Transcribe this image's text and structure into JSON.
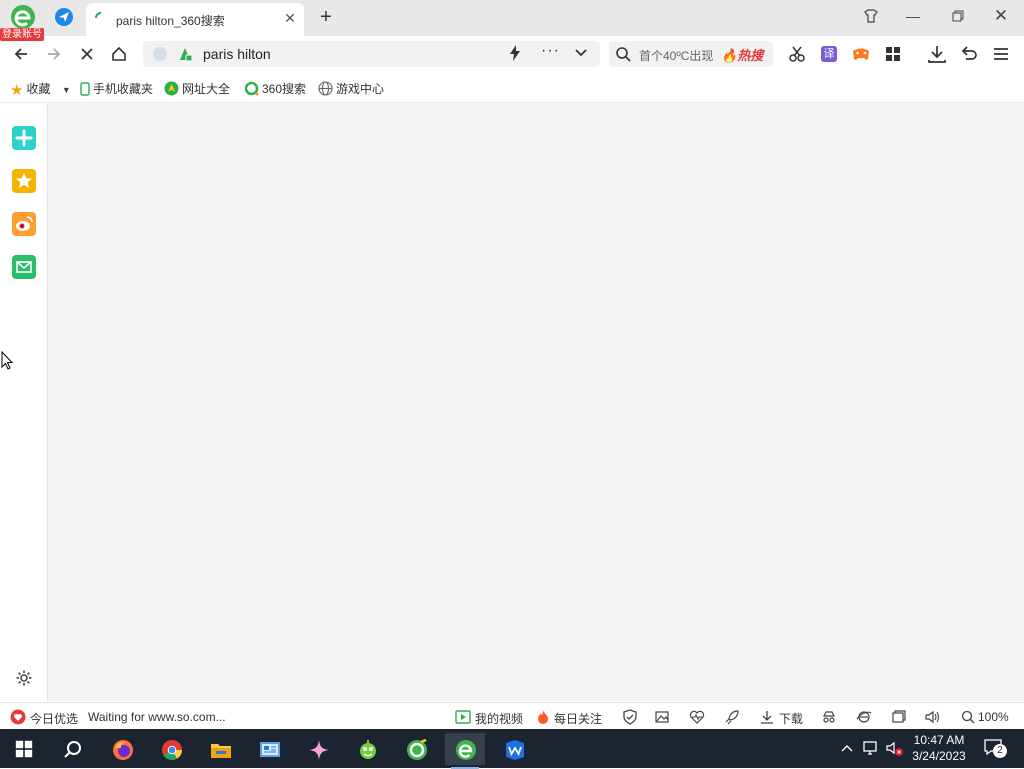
{
  "browser": {
    "login_badge": "登录账号",
    "tab": {
      "title": "paris hilton_360搜索"
    },
    "address_bar": {
      "url": "paris hilton"
    },
    "search_box": {
      "placeholder": "首个40ºC出现",
      "hot_label": "热搜"
    },
    "translate_label": "译"
  },
  "bookmarks": {
    "favorites_label": "收藏",
    "items": [
      {
        "label": "手机收藏夹",
        "icon": "phone-icon"
      },
      {
        "label": "网址大全",
        "icon": "nav-icon"
      },
      {
        "label": "360搜索",
        "icon": "search360-icon"
      },
      {
        "label": "游戏中心",
        "icon": "globe-icon"
      }
    ]
  },
  "sidebar": {
    "items": [
      {
        "icon": "add-app-icon",
        "color": "#2ad2c9"
      },
      {
        "icon": "star-icon",
        "color": "#f5b400"
      },
      {
        "icon": "weibo-icon",
        "color": "#e6162d"
      },
      {
        "icon": "mail-icon",
        "color": "#2bbd6a"
      }
    ],
    "settings_icon": "gear-icon"
  },
  "statusbar": {
    "daily_pick": "今日优选",
    "status_text": "Waiting for www.so.com...",
    "my_video": "我的视频",
    "daily_follow": "每日关注",
    "download": "下载",
    "zoom": "100%"
  },
  "taskbar": {
    "time": "10:47 AM",
    "date": "3/24/2023",
    "notifications": "2"
  },
  "colors": {
    "accent_red": "#e8393a",
    "taskbar_bg": "#1b2430"
  }
}
